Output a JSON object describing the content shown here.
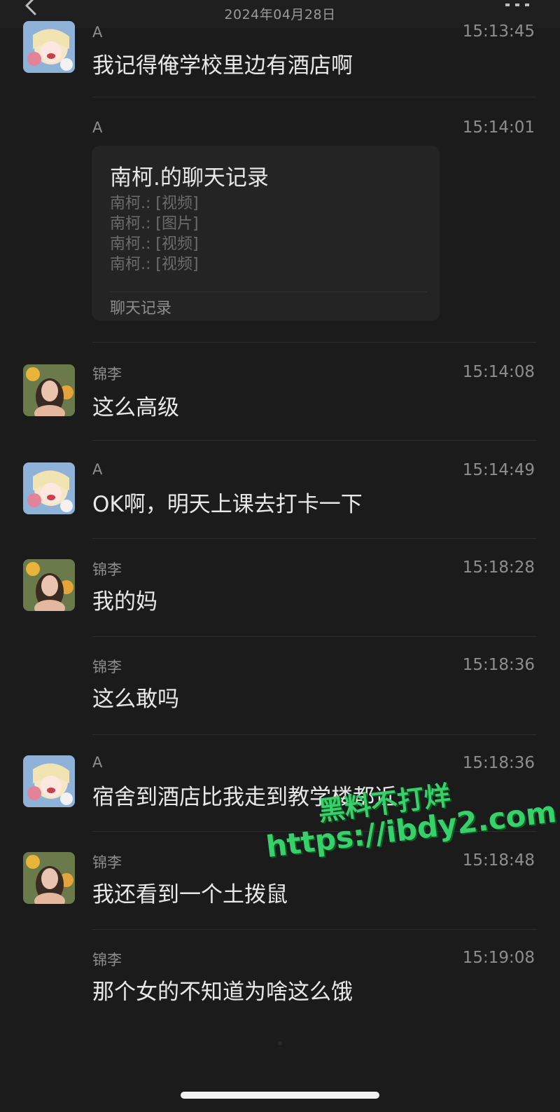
{
  "header": {
    "date": "2024年04月28日",
    "back_icon": "chevron-left-icon",
    "more_icon": "more-dots-icon"
  },
  "messages": [
    {
      "sender": "A",
      "time": "15:13:45",
      "text": "我记得俺学校里边有酒店啊",
      "avatar": "anime-avatar"
    },
    {
      "sender": "A",
      "time": "15:14:01",
      "record": {
        "title": "南柯.的聊天记录",
        "lines": [
          "南柯.: [视频]",
          "南柯.: [图片]",
          "南柯.: [视频]",
          "南柯.: [视频]"
        ],
        "footer": "聊天记录"
      }
    },
    {
      "sender": "锦李",
      "time": "15:14:08",
      "text": "这么高级",
      "avatar": "photo-avatar"
    },
    {
      "sender": "A",
      "time": "15:14:49",
      "text": "OK啊，明天上课去打卡一下",
      "avatar": "anime-avatar"
    },
    {
      "sender": "锦李",
      "time": "15:18:28",
      "text": "我的妈",
      "avatar": "photo-avatar"
    },
    {
      "sender": "锦李",
      "time": "15:18:36",
      "text": "这么敢吗"
    },
    {
      "sender": "A",
      "time": "15:18:36",
      "text": "宿舍到酒店比我走到教学楼都近",
      "avatar": "anime-avatar"
    },
    {
      "sender": "锦李",
      "time": "15:18:48",
      "text": "我还看到一个土拨鼠",
      "avatar": "photo-avatar"
    },
    {
      "sender": "锦李",
      "time": "15:19:08",
      "text": "那个女的不知道为啥这么饿"
    }
  ],
  "watermark": {
    "line1": "黑料不打烊",
    "line2": "https://ibdy2.com"
  },
  "colors": {
    "background": "#1b1b1b",
    "watermark_green": "#37d06a"
  }
}
